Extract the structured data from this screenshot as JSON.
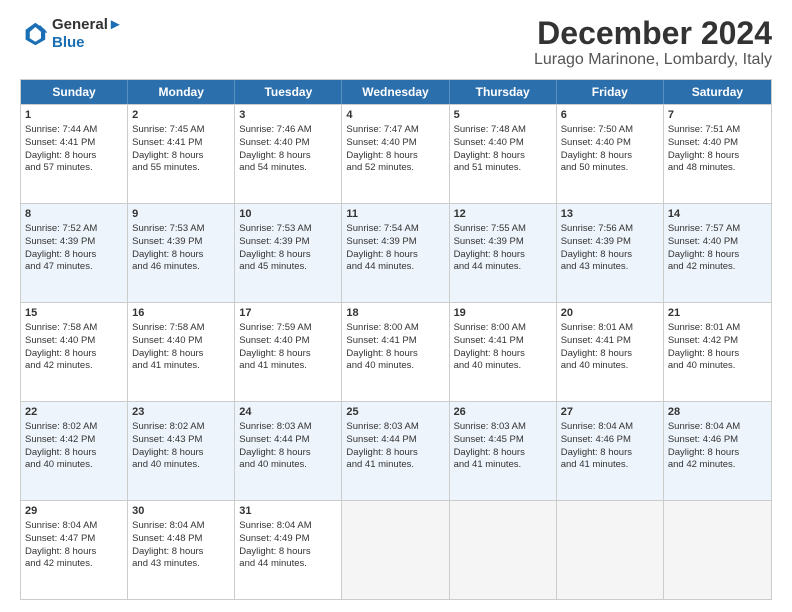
{
  "logo": {
    "line1": "General",
    "line2": "Blue"
  },
  "title": "December 2024",
  "subtitle": "Lurago Marinone, Lombardy, Italy",
  "days": [
    "Sunday",
    "Monday",
    "Tuesday",
    "Wednesday",
    "Thursday",
    "Friday",
    "Saturday"
  ],
  "weeks": [
    [
      {
        "day": "1",
        "lines": [
          "Sunrise: 7:44 AM",
          "Sunset: 4:41 PM",
          "Daylight: 8 hours",
          "and 57 minutes."
        ]
      },
      {
        "day": "2",
        "lines": [
          "Sunrise: 7:45 AM",
          "Sunset: 4:41 PM",
          "Daylight: 8 hours",
          "and 55 minutes."
        ]
      },
      {
        "day": "3",
        "lines": [
          "Sunrise: 7:46 AM",
          "Sunset: 4:40 PM",
          "Daylight: 8 hours",
          "and 54 minutes."
        ]
      },
      {
        "day": "4",
        "lines": [
          "Sunrise: 7:47 AM",
          "Sunset: 4:40 PM",
          "Daylight: 8 hours",
          "and 52 minutes."
        ]
      },
      {
        "day": "5",
        "lines": [
          "Sunrise: 7:48 AM",
          "Sunset: 4:40 PM",
          "Daylight: 8 hours",
          "and 51 minutes."
        ]
      },
      {
        "day": "6",
        "lines": [
          "Sunrise: 7:50 AM",
          "Sunset: 4:40 PM",
          "Daylight: 8 hours",
          "and 50 minutes."
        ]
      },
      {
        "day": "7",
        "lines": [
          "Sunrise: 7:51 AM",
          "Sunset: 4:40 PM",
          "Daylight: 8 hours",
          "and 48 minutes."
        ]
      }
    ],
    [
      {
        "day": "8",
        "lines": [
          "Sunrise: 7:52 AM",
          "Sunset: 4:39 PM",
          "Daylight: 8 hours",
          "and 47 minutes."
        ]
      },
      {
        "day": "9",
        "lines": [
          "Sunrise: 7:53 AM",
          "Sunset: 4:39 PM",
          "Daylight: 8 hours",
          "and 46 minutes."
        ]
      },
      {
        "day": "10",
        "lines": [
          "Sunrise: 7:53 AM",
          "Sunset: 4:39 PM",
          "Daylight: 8 hours",
          "and 45 minutes."
        ]
      },
      {
        "day": "11",
        "lines": [
          "Sunrise: 7:54 AM",
          "Sunset: 4:39 PM",
          "Daylight: 8 hours",
          "and 44 minutes."
        ]
      },
      {
        "day": "12",
        "lines": [
          "Sunrise: 7:55 AM",
          "Sunset: 4:39 PM",
          "Daylight: 8 hours",
          "and 44 minutes."
        ]
      },
      {
        "day": "13",
        "lines": [
          "Sunrise: 7:56 AM",
          "Sunset: 4:39 PM",
          "Daylight: 8 hours",
          "and 43 minutes."
        ]
      },
      {
        "day": "14",
        "lines": [
          "Sunrise: 7:57 AM",
          "Sunset: 4:40 PM",
          "Daylight: 8 hours",
          "and 42 minutes."
        ]
      }
    ],
    [
      {
        "day": "15",
        "lines": [
          "Sunrise: 7:58 AM",
          "Sunset: 4:40 PM",
          "Daylight: 8 hours",
          "and 42 minutes."
        ]
      },
      {
        "day": "16",
        "lines": [
          "Sunrise: 7:58 AM",
          "Sunset: 4:40 PM",
          "Daylight: 8 hours",
          "and 41 minutes."
        ]
      },
      {
        "day": "17",
        "lines": [
          "Sunrise: 7:59 AM",
          "Sunset: 4:40 PM",
          "Daylight: 8 hours",
          "and 41 minutes."
        ]
      },
      {
        "day": "18",
        "lines": [
          "Sunrise: 8:00 AM",
          "Sunset: 4:41 PM",
          "Daylight: 8 hours",
          "and 40 minutes."
        ]
      },
      {
        "day": "19",
        "lines": [
          "Sunrise: 8:00 AM",
          "Sunset: 4:41 PM",
          "Daylight: 8 hours",
          "and 40 minutes."
        ]
      },
      {
        "day": "20",
        "lines": [
          "Sunrise: 8:01 AM",
          "Sunset: 4:41 PM",
          "Daylight: 8 hours",
          "and 40 minutes."
        ]
      },
      {
        "day": "21",
        "lines": [
          "Sunrise: 8:01 AM",
          "Sunset: 4:42 PM",
          "Daylight: 8 hours",
          "and 40 minutes."
        ]
      }
    ],
    [
      {
        "day": "22",
        "lines": [
          "Sunrise: 8:02 AM",
          "Sunset: 4:42 PM",
          "Daylight: 8 hours",
          "and 40 minutes."
        ]
      },
      {
        "day": "23",
        "lines": [
          "Sunrise: 8:02 AM",
          "Sunset: 4:43 PM",
          "Daylight: 8 hours",
          "and 40 minutes."
        ]
      },
      {
        "day": "24",
        "lines": [
          "Sunrise: 8:03 AM",
          "Sunset: 4:44 PM",
          "Daylight: 8 hours",
          "and 40 minutes."
        ]
      },
      {
        "day": "25",
        "lines": [
          "Sunrise: 8:03 AM",
          "Sunset: 4:44 PM",
          "Daylight: 8 hours",
          "and 41 minutes."
        ]
      },
      {
        "day": "26",
        "lines": [
          "Sunrise: 8:03 AM",
          "Sunset: 4:45 PM",
          "Daylight: 8 hours",
          "and 41 minutes."
        ]
      },
      {
        "day": "27",
        "lines": [
          "Sunrise: 8:04 AM",
          "Sunset: 4:46 PM",
          "Daylight: 8 hours",
          "and 41 minutes."
        ]
      },
      {
        "day": "28",
        "lines": [
          "Sunrise: 8:04 AM",
          "Sunset: 4:46 PM",
          "Daylight: 8 hours",
          "and 42 minutes."
        ]
      }
    ],
    [
      {
        "day": "29",
        "lines": [
          "Sunrise: 8:04 AM",
          "Sunset: 4:47 PM",
          "Daylight: 8 hours",
          "and 42 minutes."
        ]
      },
      {
        "day": "30",
        "lines": [
          "Sunrise: 8:04 AM",
          "Sunset: 4:48 PM",
          "Daylight: 8 hours",
          "and 43 minutes."
        ]
      },
      {
        "day": "31",
        "lines": [
          "Sunrise: 8:04 AM",
          "Sunset: 4:49 PM",
          "Daylight: 8 hours",
          "and 44 minutes."
        ]
      },
      {
        "day": "",
        "lines": []
      },
      {
        "day": "",
        "lines": []
      },
      {
        "day": "",
        "lines": []
      },
      {
        "day": "",
        "lines": []
      }
    ]
  ]
}
